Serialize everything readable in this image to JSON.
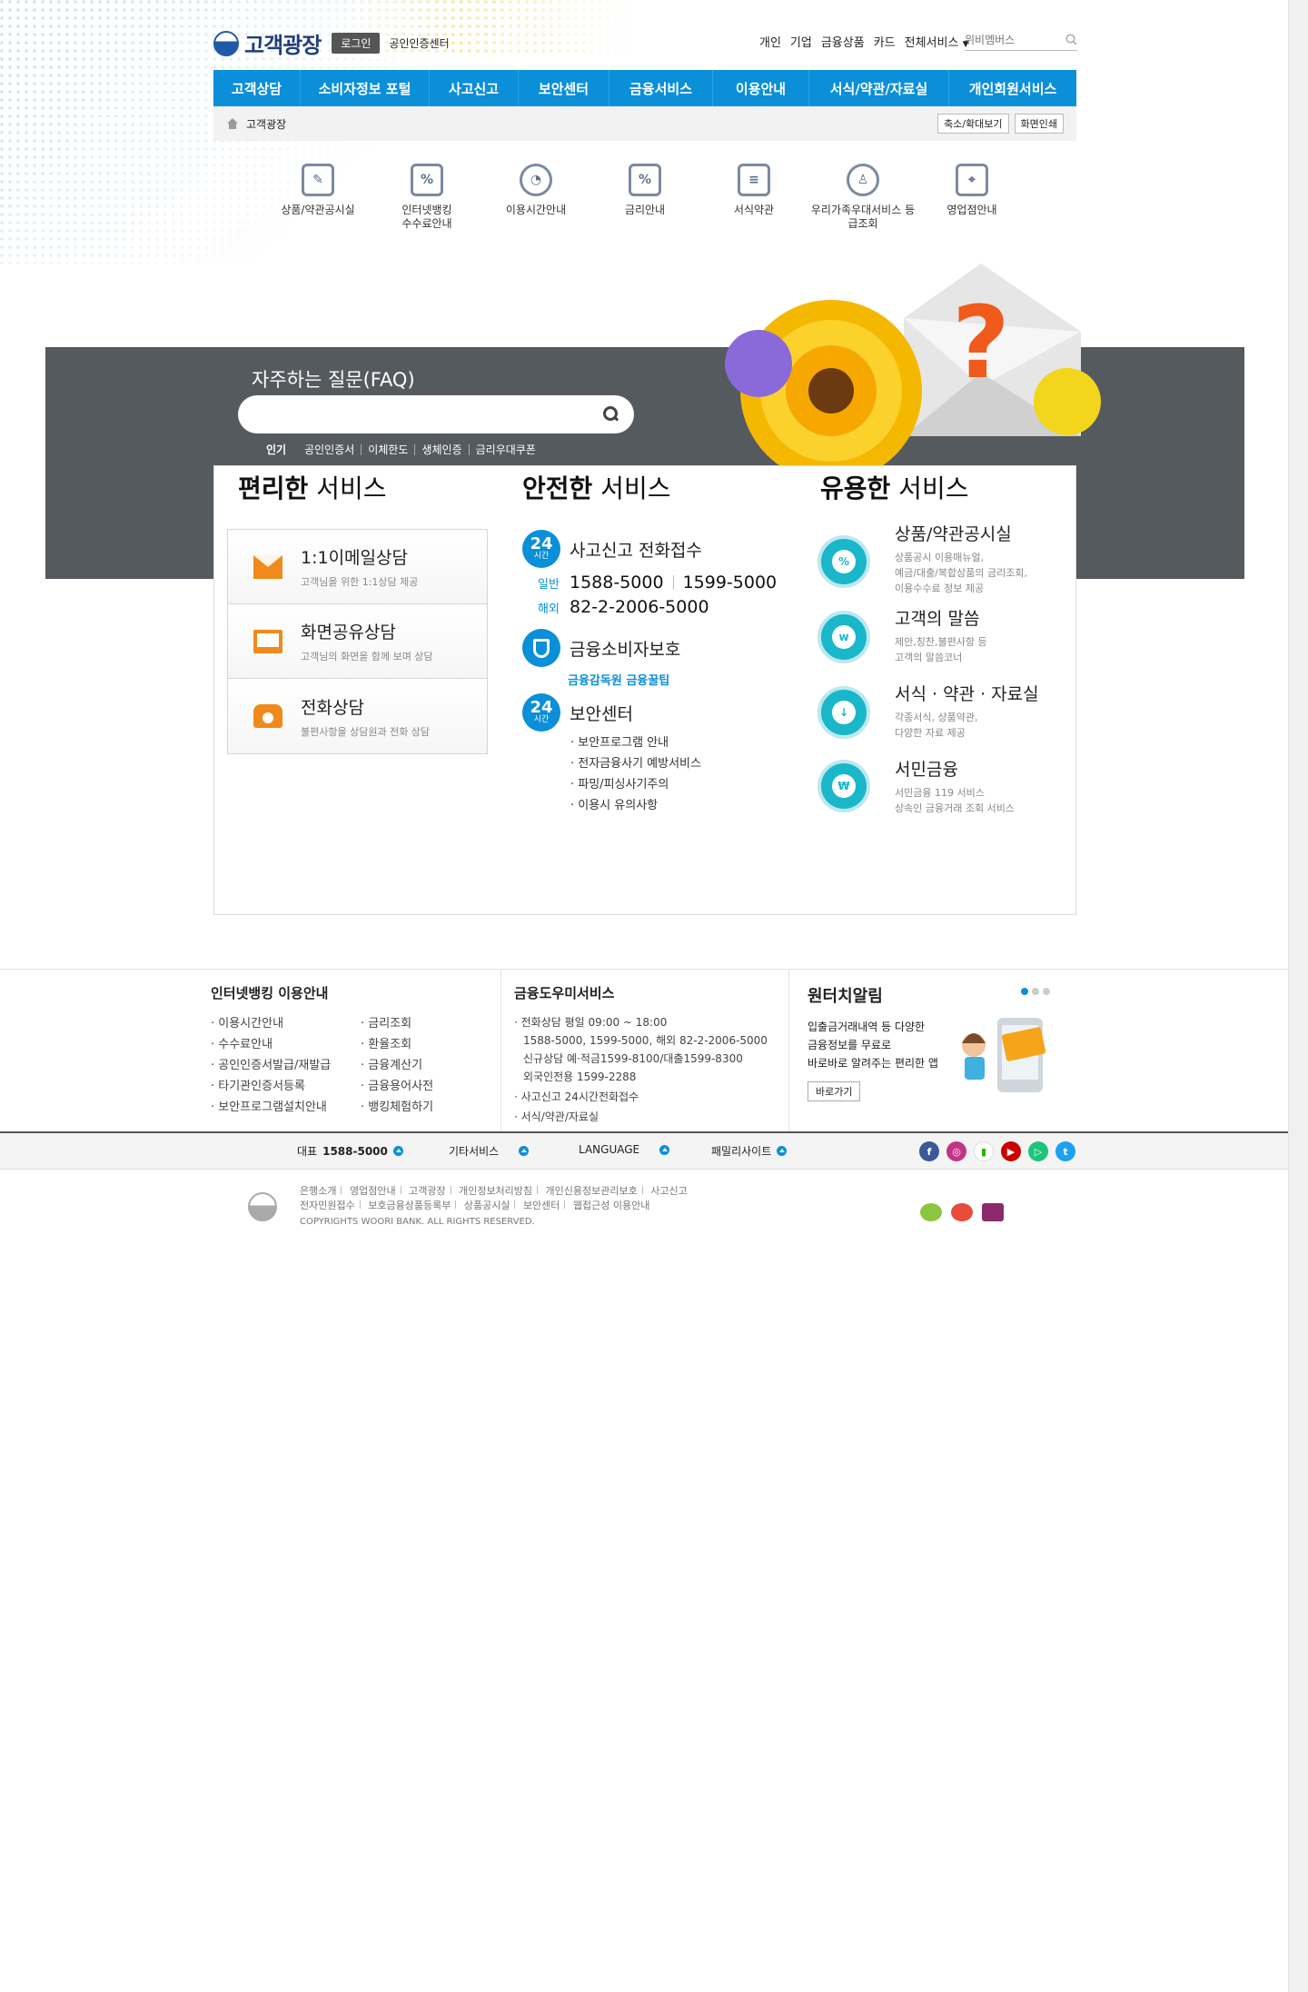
{
  "header": {
    "logo_text": "고객광장",
    "login_label": "로그인",
    "cert_center": "공인인증센터",
    "top_menu": [
      "개인",
      "기업",
      "금융상품",
      "카드",
      "전체서비스"
    ],
    "search_placeholder": "위비멤버스"
  },
  "gnb": [
    "고객상담",
    "소비자정보 포털",
    "사고신고",
    "보안센터",
    "금융서비스",
    "이용안내",
    "서식/약관/자료실",
    "개인회원서비스"
  ],
  "breadcrumb": {
    "current": "고객광장",
    "zoom_button": "축소/확대보기",
    "print_button": "화면인쇄"
  },
  "quick_links": [
    {
      "label": "상품/약관공시실",
      "icon": "document-edit-icon"
    },
    {
      "label": "인터넷뱅킹 수수료안내",
      "icon": "monitor-percent-icon"
    },
    {
      "label": "이용시간안내",
      "icon": "clock-icon"
    },
    {
      "label": "금리안내",
      "icon": "percent-tag-icon"
    },
    {
      "label": "서식약관",
      "icon": "form-icon"
    },
    {
      "label": "우리가족우대서비스 등급조회",
      "icon": "family-badge-icon"
    },
    {
      "label": "영업점안내",
      "icon": "map-pin-icon"
    }
  ],
  "faq": {
    "title": "자주하는 질문(FAQ)",
    "input_value": "",
    "tags": [
      "인기",
      "공인인증서",
      "이체한도",
      "생체인증",
      "금리우대쿠폰"
    ]
  },
  "convenient": {
    "title_bold": "편리한",
    "title_rest": " 서비스",
    "items": [
      {
        "title": "1:1이메일상담",
        "desc": "고객님을 위한 1:1상담 제공",
        "icon": "mail-icon"
      },
      {
        "title": "화면공유상담",
        "desc": "고객님의 화면을 함께 보며 상담",
        "icon": "monitor-icon"
      },
      {
        "title": "전화상담",
        "desc": "불편사항을 상담원과 전화 상담",
        "icon": "phone-icon"
      }
    ]
  },
  "safe": {
    "title_bold": "안전한",
    "title_rest": " 서비스",
    "badge_num": "24",
    "badge_sub": "시간",
    "accident_title": "사고신고 전화접수",
    "general_label": "일반",
    "general_phone1": "1588-5000",
    "general_phone2": "1599-5000",
    "overseas_label": "해외",
    "overseas_phone": "82-2-2006-5000",
    "consumer_title": "금융소비자보호",
    "consumer_links": "금융감독원 금융꿀팁",
    "security_title": "보안센터",
    "security_items": [
      "보안프로그램 안내",
      "전자금융사기 예방서비스",
      "파밍/피싱사기주의",
      "이용시 유의사항"
    ]
  },
  "useful": {
    "title_bold": "유용한",
    "title_rest": " 서비스",
    "items": [
      {
        "title": "상품/약관공시실",
        "desc": [
          "상품공시 이용매뉴얼,",
          "예금/대출/복합상품의 금리조회,",
          "이용수수료 정보 제공"
        ],
        "icon": "percent-icon"
      },
      {
        "title": "고객의 말씀",
        "desc": [
          "제안,칭찬,불편사항 등",
          "고객의 말씀코너"
        ],
        "icon": "customer-icon"
      },
      {
        "title": "서식 · 약관 · 자료실",
        "desc": [
          "각종서식, 상품약관,",
          "다양한 자료 제공"
        ],
        "icon": "download-doc-icon"
      },
      {
        "title": "서민금융",
        "desc": [
          "서민금융 119 서비스",
          "상속인 금융거래 조회 서비스"
        ],
        "icon": "won-119-icon"
      }
    ]
  },
  "footer_info": {
    "ib_title": "인터넷뱅킹 이용안내",
    "ib_col1": [
      "이용시간안내",
      "수수료안내",
      "공인인증서발급/재발급",
      "타기관인증서등록",
      "보안프로그램설치안내"
    ],
    "ib_col2": [
      "금리조회",
      "환율조회",
      "금융계산기",
      "금융용어사전",
      "뱅킹체험하기"
    ],
    "helper_title": "금융도우미서비스",
    "helper_lines": [
      "전화상담 평일 09:00 ~ 18:00",
      "1588-5000, 1599-5000, 해외 82-2-2006-5000",
      "신규상담 예·적금1599-8100/대출1599-8300",
      "외국인전용 1599-2288",
      "사고신고 24시간전화접수",
      "서식/약관/자료실"
    ],
    "wonter_title": "원터치알림",
    "wonter_desc": [
      "입출금거래내역 등 다양한",
      "금융정보를 무료로",
      "바로바로 알려주는 편리한 앱"
    ],
    "wonter_button": "바로가기"
  },
  "footer_band": {
    "rep": "대표",
    "rep_phone": "1588-5000",
    "other": "기타서비스",
    "lang": "LANGUAGE",
    "family": "패밀리사이트"
  },
  "copyright": {
    "links1": [
      "은행소개",
      "영업점안내",
      "고객광장",
      "개인정보처리방침",
      "개인신용정보관리보호",
      "사고신고"
    ],
    "links2": [
      "전자민원접수",
      "보호금융상품등록부",
      "상품공시실",
      "보안센터",
      "웹접근성 이용안내"
    ],
    "text": "COPYRIGHTS WOORI BANK. ALL RIGHTS RESERVED."
  },
  "colors": {
    "primary": "#0a8fd8",
    "band": "#555a5f",
    "accent_orange": "#f08a1c",
    "teal": "#19b7c9"
  }
}
